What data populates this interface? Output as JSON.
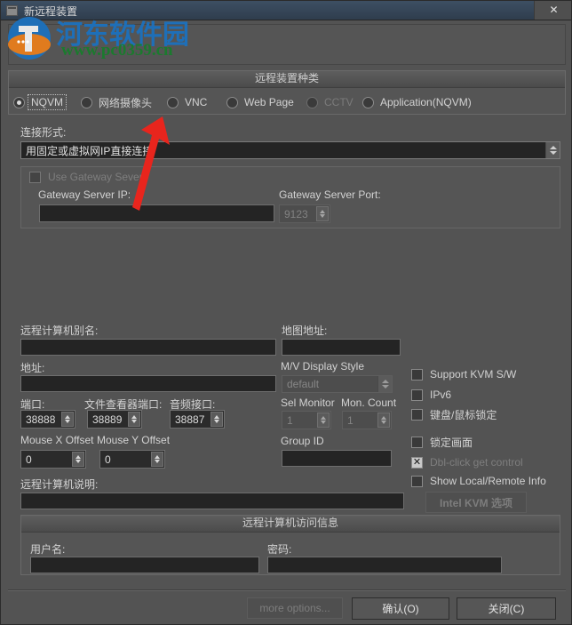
{
  "window": {
    "title": "新远程装置",
    "close_label": "✕",
    "icon": "window-icon"
  },
  "watermark": {
    "site_cn": "河东软件园",
    "site_url": "www.pc0359.cn"
  },
  "device_type_group": {
    "header": "远程装置种类",
    "options": [
      {
        "label": "NQVM",
        "checked": true,
        "disabled": false,
        "focused": true
      },
      {
        "label": "网络摄像头",
        "checked": false,
        "disabled": false,
        "focused": false
      },
      {
        "label": "VNC",
        "checked": false,
        "disabled": false,
        "focused": false
      },
      {
        "label": "Web Page",
        "checked": false,
        "disabled": false,
        "focused": false
      },
      {
        "label": "CCTV",
        "checked": false,
        "disabled": true,
        "focused": false
      },
      {
        "label": "Application(NQVM)",
        "checked": false,
        "disabled": false,
        "focused": false
      }
    ]
  },
  "connection": {
    "label": "连接形式:",
    "selected": "用固定或虚拟网IP直接连接",
    "gateway": {
      "use_label": "Use Gateway Sever",
      "use_checked": false,
      "use_disabled": true,
      "ip_label": "Gateway Server IP:",
      "ip_value": "",
      "port_label": "Gateway Server Port:",
      "port_value": "9123",
      "port_disabled": true
    }
  },
  "remote": {
    "alias_label": "远程计算机别名:",
    "alias_value": "",
    "address_label": "地址:",
    "address_value": "",
    "port_label": "端口:",
    "port_value": "38888",
    "file_viewer_port_label": "文件查看器端口:",
    "file_viewer_port_value": "38889",
    "audio_port_label": "音频接口:",
    "audio_port_value": "38887",
    "mouse_x_label": "Mouse X Offset",
    "mouse_x_value": "0",
    "mouse_y_label": "Mouse Y Offset",
    "mouse_y_value": "0",
    "description_label": "远程计算机说明:",
    "description_value": ""
  },
  "display": {
    "map_address_label": "地图地址:",
    "map_address_value": "",
    "mv_style_label": "M/V Display Style",
    "mv_style_value": "default",
    "mv_style_disabled": true,
    "sel_monitor_label": "Sel Monitor",
    "sel_monitor_value": "1",
    "sel_monitor_disabled": true,
    "mon_count_label": "Mon. Count",
    "mon_count_value": "1",
    "mon_count_disabled": true,
    "group_id_label": "Group ID",
    "group_id_value": ""
  },
  "options": [
    {
      "label": "Support KVM S/W",
      "checked": false,
      "disabled": false
    },
    {
      "label": "IPv6",
      "checked": false,
      "disabled": false
    },
    {
      "label": "键盘/鼠标锁定",
      "checked": false,
      "disabled": false
    },
    {
      "label": "锁定画面",
      "checked": false,
      "disabled": false
    },
    {
      "label": "Dbl-click get control",
      "checked": true,
      "disabled": true
    },
    {
      "label": "Show Local/Remote Info",
      "checked": false,
      "disabled": false
    }
  ],
  "intel_kvm_button": {
    "label": "Intel KVM 选项",
    "disabled": true
  },
  "access_group": {
    "header": "远程计算机访问信息",
    "username_label": "用户名:",
    "username_value": "",
    "password_label": "密码:",
    "password_value": ""
  },
  "footer": {
    "more_options_label": "more options...",
    "more_options_disabled": true,
    "ok_label": "确认(O)",
    "close_label": "关闭(C)"
  },
  "colors": {
    "dialog_bg": "#535353",
    "titlebar": "#35465a",
    "input_bg": "#242424",
    "text": "#d2d2d2",
    "disabled_text": "#7e7e7e",
    "watermark_blue": "#1e6fb8",
    "watermark_green": "#1b7a2e",
    "annotation_red": "#e8251d"
  }
}
